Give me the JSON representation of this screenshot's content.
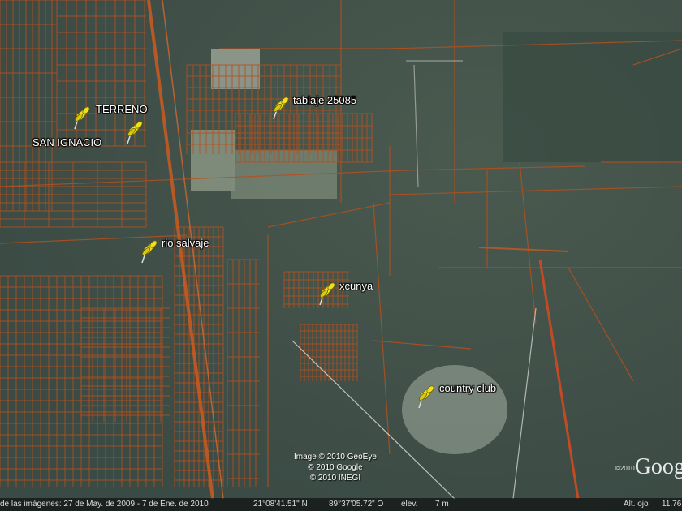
{
  "placemarks": [
    {
      "label": "TERRENO"
    },
    {
      "label": "SAN IGNACIO"
    },
    {
      "label": "tablaje 25085"
    },
    {
      "label": "rio salvaje"
    },
    {
      "label": "xcunya"
    },
    {
      "label": "country club"
    }
  ],
  "attribution": {
    "line1": "Image © 2010 GeoEye",
    "line2": "© 2010 Google",
    "line3": "© 2010 INEGI"
  },
  "logo": {
    "year": "©2010",
    "text": "Google"
  },
  "status": {
    "imagery_dates": "de las imágenes: 27 de May. de 2009 - 7 de Ene. de 2010",
    "latitude": "21°08'41.51\" N",
    "longitude": "89°37'05.72\" O",
    "elevation_label": "elev.",
    "elevation_value": "7 m",
    "eye_alt_label": "Alt. ojo",
    "eye_alt_value": "11.76"
  },
  "colors": {
    "parcel": "#b4501e",
    "pin": "#f0e020",
    "bg": "#3e4f47"
  }
}
